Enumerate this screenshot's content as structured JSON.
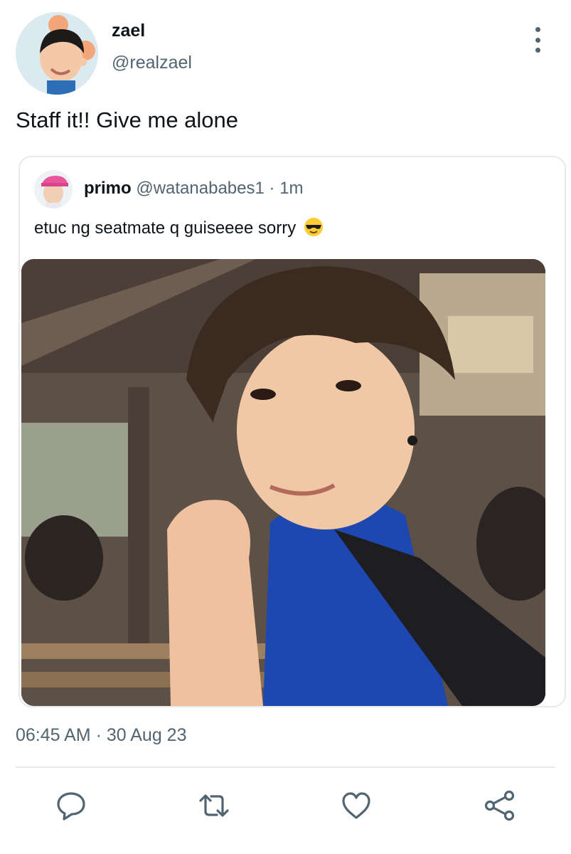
{
  "author": {
    "display_name": "zael",
    "handle": "@realzael",
    "avatar_icon": "profile-photo"
  },
  "tweet": {
    "text": "Staff it!! Give me alone"
  },
  "quoted_tweet": {
    "display_name": "primo",
    "handle": "@watanababes1",
    "separator": "·",
    "time_ago": "1m",
    "text": "etuc ng seatmate q guiseeee sorry",
    "emoji": "sunglasses-face-emoji",
    "media_icon": "photo-of-boy-in-blue-shirt"
  },
  "timestamp": {
    "time": "06:45 AM",
    "separator": "·",
    "date": "30 Aug 23"
  },
  "actions": [
    {
      "icon": "reply-icon"
    },
    {
      "icon": "retweet-icon"
    },
    {
      "icon": "like-icon"
    },
    {
      "icon": "share-icon"
    }
  ],
  "colors": {
    "text_primary": "#0f1419",
    "text_secondary": "#536471",
    "border": "#e6e9eb",
    "icon": "#536471"
  }
}
